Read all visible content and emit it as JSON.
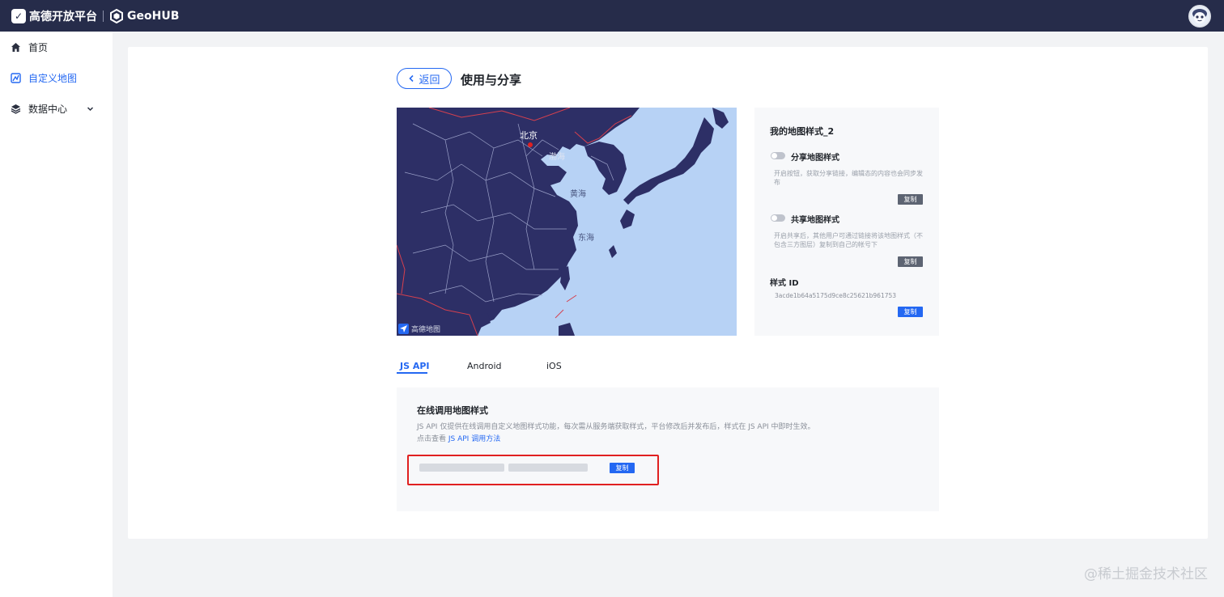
{
  "header": {
    "logo_text": "高德开放平台",
    "product_text": "GeoHUB"
  },
  "sidebar": {
    "items": [
      {
        "label": "首页",
        "icon": "home-icon"
      },
      {
        "label": "自定义地图",
        "icon": "custom-map-icon",
        "active": true
      },
      {
        "label": "数据中心",
        "icon": "layers-icon",
        "expandable": true
      }
    ]
  },
  "page": {
    "back_label": "返回",
    "title": "使用与分享"
  },
  "map": {
    "labels": {
      "beijing": "北京",
      "bohai": "渤海",
      "yellow_sea": "黄海",
      "east_sea": "东海"
    },
    "watermark": "高德地图",
    "colors": {
      "land": "#2d2f66",
      "sea": "#b7d2f5",
      "border": "#9aa0c8",
      "country_border": "#d6404e"
    }
  },
  "style_card": {
    "title": "我的地图样式_2",
    "share": {
      "label": "分享地图样式",
      "desc": "开启按钮，获取分享链接，编辑态的内容也会同步发布",
      "copy_label": "复制"
    },
    "co_share": {
      "label": "共享地图样式",
      "desc": "开启共享后，其他用户可通过链接将该地图样式（不包含三方图层）复制到自己的帐号下",
      "copy_label": "复制"
    },
    "style_id": {
      "label": "样式 ID",
      "value": "3acde1b64a5175d9ce8c25621b961753",
      "copy_label": "复制"
    }
  },
  "tabs": [
    {
      "label": "JS API",
      "active": true
    },
    {
      "label": "Android",
      "active": false
    },
    {
      "label": "iOS",
      "active": false
    }
  ],
  "api_section": {
    "title": "在线调用地图样式",
    "desc": "JS API 仅提供在线调用自定义地图样式功能，每次需从服务端获取样式，平台修改后并发布后，样式在 JS API 中即时生效。",
    "link_prefix": "点击查看 ",
    "link_text": "JS API 调用方法",
    "copy_label": "复制"
  },
  "site_watermark": "@稀土掘金技术社区",
  "colors": {
    "accent": "#2468f2",
    "topbar": "#262c4a",
    "highlight": "#e02020"
  }
}
